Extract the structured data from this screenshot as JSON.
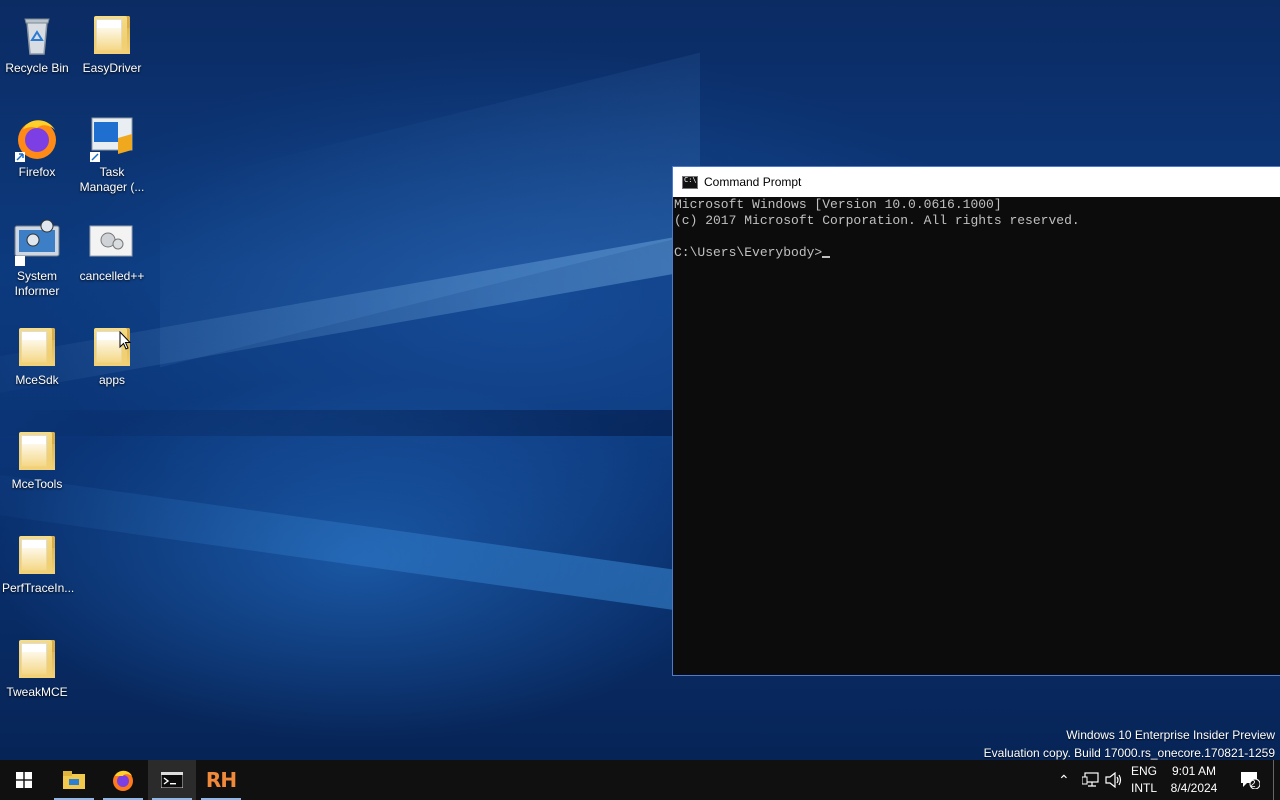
{
  "desktop": {
    "icons": [
      {
        "label": "Recycle Bin"
      },
      {
        "label": "EasyDriver"
      },
      {
        "label": "Firefox"
      },
      {
        "label": "Task Manager (..."
      },
      {
        "label": "System Informer"
      },
      {
        "label": "cancelled++"
      },
      {
        "label": "MceSdk"
      },
      {
        "label": "apps"
      },
      {
        "label": "MceTools"
      },
      {
        "label": "PerfTraceIn..."
      },
      {
        "label": "TweakMCE"
      }
    ]
  },
  "cmd_window": {
    "title": "Command Prompt",
    "lines": [
      "Microsoft Windows [Version 10.0.0616.1000]",
      "(c) 2017 Microsoft Corporation. All rights reserved.",
      "",
      "C:\\Users\\Everybody>"
    ]
  },
  "watermark": {
    "line1": "Windows 10 Enterprise Insider Preview",
    "line2": "Evaluation copy. Build 17000.rs_onecore.170821-1259"
  },
  "taskbar": {
    "apps": [
      "start",
      "file-explorer",
      "firefox",
      "command-prompt",
      "rh-app"
    ],
    "rh_label": "RH",
    "language_top": "ENG",
    "language_bottom": "INTL",
    "time": "9:01 AM",
    "date": "8/4/2024",
    "notification_count": "2"
  }
}
